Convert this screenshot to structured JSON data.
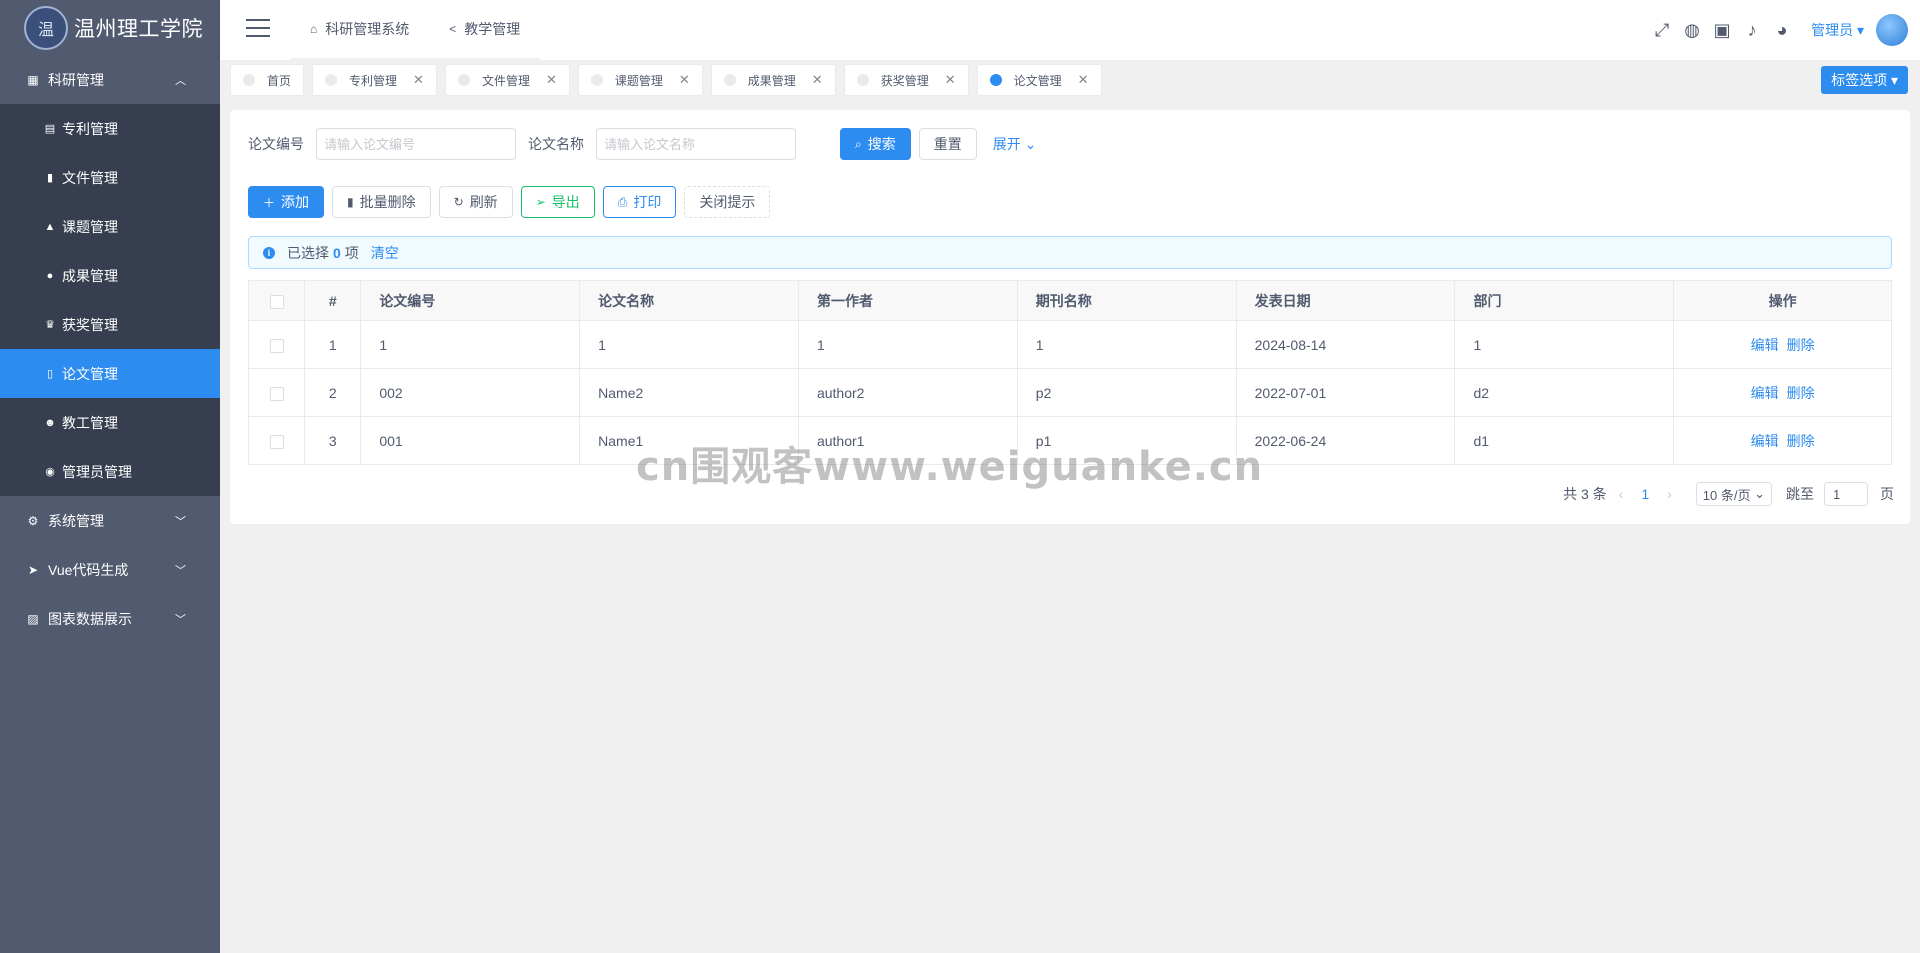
{
  "app": {
    "logo_text": "温州理工学院",
    "logo_mark": "温"
  },
  "sidebar": {
    "groups": [
      {
        "label": "科研管理",
        "icon": "grid-icon",
        "expanded": true,
        "items": [
          {
            "label": "专利管理",
            "icon": "doc-icon"
          },
          {
            "label": "文件管理",
            "icon": "file-icon"
          },
          {
            "label": "课题管理",
            "icon": "flask-icon"
          },
          {
            "label": "成果管理",
            "icon": "circle-icon"
          },
          {
            "label": "获奖管理",
            "icon": "trophy-icon"
          },
          {
            "label": "论文管理",
            "icon": "book-icon",
            "active": true
          },
          {
            "label": "教工管理",
            "icon": "people-icon"
          },
          {
            "label": "管理员管理",
            "icon": "user-circle-icon"
          }
        ]
      },
      {
        "label": "系统管理",
        "icon": "gear-icon"
      },
      {
        "label": "Vue代码生成",
        "icon": "send-icon"
      },
      {
        "label": "图表数据展示",
        "icon": "chart-icon"
      }
    ]
  },
  "header": {
    "nav": [
      {
        "label": "科研管理系统",
        "icon": "home-icon"
      },
      {
        "label": "教学管理",
        "icon": "share-icon"
      }
    ],
    "user": "管理员"
  },
  "tags": {
    "items": [
      {
        "label": "首页",
        "closable": false,
        "active": false
      },
      {
        "label": "专利管理",
        "closable": true,
        "active": false
      },
      {
        "label": "文件管理",
        "closable": true,
        "active": false
      },
      {
        "label": "课题管理",
        "closable": true,
        "active": false
      },
      {
        "label": "成果管理",
        "closable": true,
        "active": false
      },
      {
        "label": "获奖管理",
        "closable": true,
        "active": false
      },
      {
        "label": "论文管理",
        "closable": true,
        "active": true
      }
    ],
    "options_label": "标签选项"
  },
  "search": {
    "code_label": "论文编号",
    "code_placeholder": "请输入论文编号",
    "name_label": "论文名称",
    "name_placeholder": "请输入论文名称",
    "search_btn": "搜索",
    "reset_btn": "重置",
    "expand_link": "展开"
  },
  "actions": {
    "add": "添加",
    "batch_delete": "批量删除",
    "refresh": "刷新",
    "export": "导出",
    "print": "打印",
    "close_tip": "关闭提示"
  },
  "alert": {
    "prefix": "已选择",
    "count": "0",
    "suffix": "项",
    "clear": "清空"
  },
  "table": {
    "headers": [
      "#",
      "论文编号",
      "论文名称",
      "第一作者",
      "期刊名称",
      "发表日期",
      "部门",
      "操作"
    ],
    "rows": [
      [
        "1",
        "1",
        "1",
        "1",
        "1",
        "2024-08-14",
        "1"
      ],
      [
        "2",
        "002",
        "Name2",
        "author2",
        "p2",
        "2022-07-01",
        "d2"
      ],
      [
        "3",
        "001",
        "Name1",
        "author1",
        "p1",
        "2022-06-24",
        "d1"
      ]
    ],
    "edit_label": "编辑",
    "delete_label": "删除"
  },
  "pager": {
    "total": "共 3 条",
    "current": "1",
    "size": "10 条/页",
    "jump_label": "跳至",
    "jump_value": "1",
    "page_suffix": "页"
  },
  "watermark": "cn围观客www.weiguanke.cn",
  "colors": {
    "primary": "#2d8cf0",
    "sidebar": "#515a6e",
    "submenu": "#363e4f",
    "success": "#19be6b"
  }
}
